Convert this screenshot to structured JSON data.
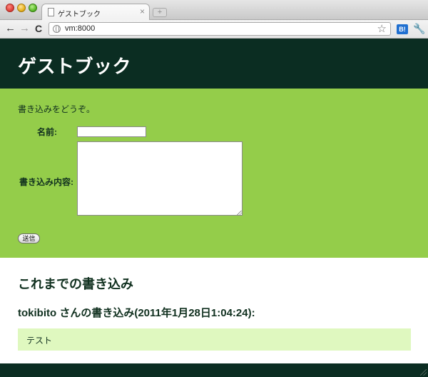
{
  "browser": {
    "tab_title": "ゲストブック",
    "tab_close": "×",
    "new_tab": "+",
    "url": "vm:8000",
    "back": "←",
    "forward": "→",
    "reload": "C",
    "star": "☆",
    "hatena_label": "B!",
    "wrench": "🔧"
  },
  "page": {
    "title": "ゲストブック",
    "form": {
      "intro": "書き込みをどうぞ。",
      "name_label": "名前:",
      "name_value": "",
      "content_label": "書き込み内容:",
      "content_value": "",
      "submit_label": "送信"
    },
    "history": {
      "heading": "これまでの書き込み",
      "entries": [
        {
          "heading": "tokibito さんの書き込み(2011年1月28日1:04:24):",
          "body": "テスト"
        }
      ]
    }
  },
  "colors": {
    "header_bg": "#0b2d22",
    "form_bg": "#94cd4a",
    "entry_bg": "#dff8bf",
    "text_dark": "#10301f"
  }
}
